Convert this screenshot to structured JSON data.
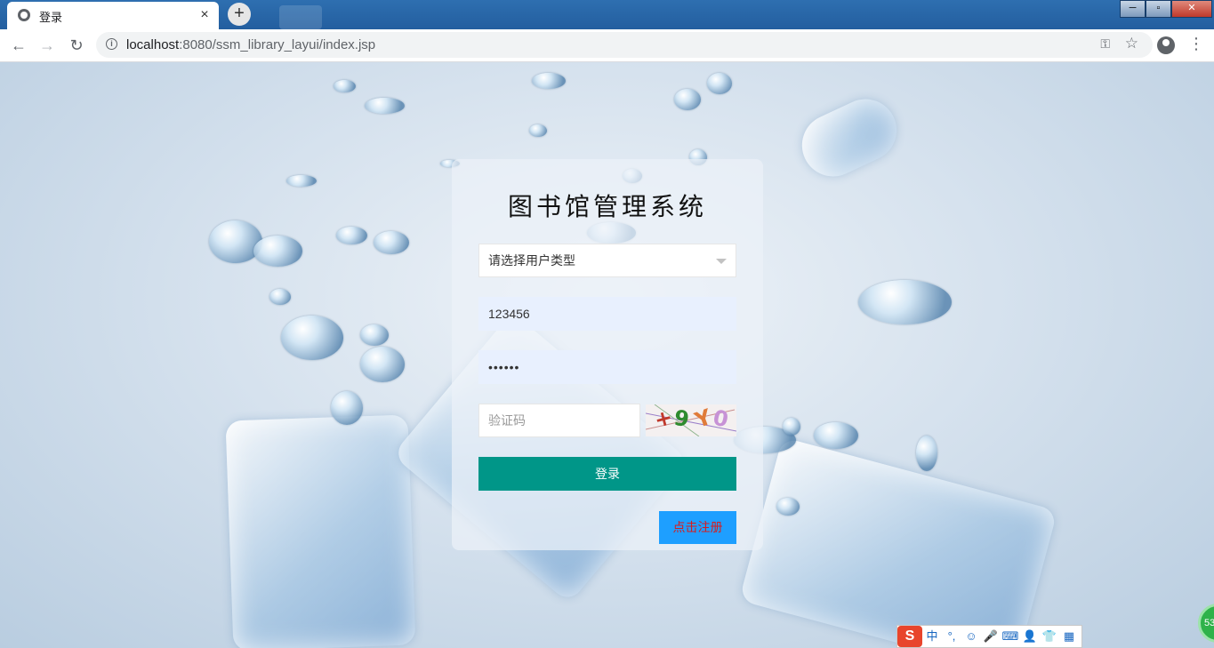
{
  "browser": {
    "tab_title": "登录",
    "tab_close": "×",
    "new_tab": "+",
    "url_host": "localhost",
    "url_rest": ":8080/ssm_library_layui/index.jsp",
    "window_buttons": [
      "─",
      "▫",
      "✕"
    ]
  },
  "login": {
    "title": "图书馆管理系统",
    "user_type_placeholder": "请选择用户类型",
    "username_value": "123456",
    "password_value": "••••••",
    "captcha_placeholder": "验证码",
    "captcha_chars": [
      "+",
      "9",
      "Y",
      "0"
    ],
    "login_label": "登录",
    "register_label": "点击注册"
  },
  "ime": {
    "logo": "S",
    "items": [
      "中",
      "°,",
      "☺",
      "🎤",
      "⌨",
      "👤",
      "👕",
      "▦"
    ]
  },
  "float_ball": "53",
  "colors": {
    "login_button": "#009688",
    "register_button": "#1e9fff",
    "register_text": "#d81b1b",
    "autofill_bg": "#e8f0fe"
  }
}
